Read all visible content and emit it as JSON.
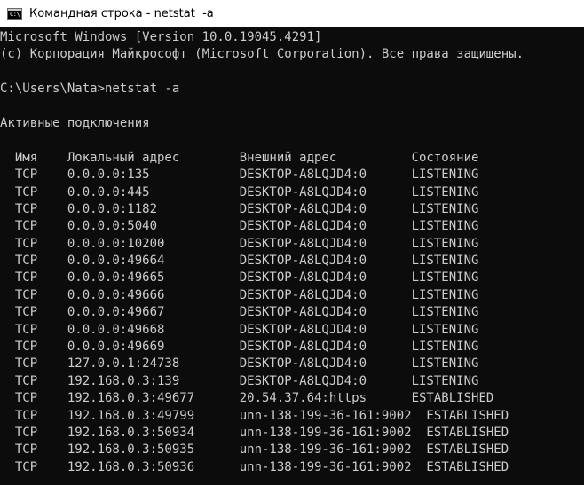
{
  "window": {
    "title": "Командная строка - netstat  -a",
    "icon": "cmd-icon",
    "icon_glyph": "C:\\",
    "background": "#0c0c0c",
    "foreground": "#cccccc"
  },
  "console": {
    "lines": [
      "Microsoft Windows [Version 10.0.19045.4291]",
      "(c) Корпорация Майкрософт (Microsoft Corporation). Все права защищены.",
      "",
      "C:\\Users\\Nata>netstat -a",
      "",
      "Активные подключения",
      "",
      "  Имя    Локальный адрес        Внешний адрес          Состояние",
      "  TCP    0.0.0.0:135            DESKTOP-A8LQJD4:0      LISTENING",
      "  TCP    0.0.0.0:445            DESKTOP-A8LQJD4:0      LISTENING",
      "  TCP    0.0.0.0:1182           DESKTOP-A8LQJD4:0      LISTENING",
      "  TCP    0.0.0.0:5040           DESKTOP-A8LQJD4:0      LISTENING",
      "  TCP    0.0.0.0:10200          DESKTOP-A8LQJD4:0      LISTENING",
      "  TCP    0.0.0.0:49664          DESKTOP-A8LQJD4:0      LISTENING",
      "  TCP    0.0.0.0:49665          DESKTOP-A8LQJD4:0      LISTENING",
      "  TCP    0.0.0.0:49666          DESKTOP-A8LQJD4:0      LISTENING",
      "  TCP    0.0.0.0:49667          DESKTOP-A8LQJD4:0      LISTENING",
      "  TCP    0.0.0.0:49668          DESKTOP-A8LQJD4:0      LISTENING",
      "  TCP    0.0.0.0:49669          DESKTOP-A8LQJD4:0      LISTENING",
      "  TCP    127.0.0.1:24738        DESKTOP-A8LQJD4:0      LISTENING",
      "  TCP    192.168.0.3:139        DESKTOP-A8LQJD4:0      LISTENING",
      "  TCP    192.168.0.3:49677      20.54.37.64:https      ESTABLISHED",
      "  TCP    192.168.0.3:49799      unn-138-199-36-161:9002  ESTABLISHED",
      "  TCP    192.168.0.3:50934      unn-138-199-36-161:9002  ESTABLISHED",
      "  TCP    192.168.0.3:50935      unn-138-199-36-161:9002  ESTABLISHED",
      "  TCP    192.168.0.3:50936      unn-138-199-36-161:9002  ESTABLISHED"
    ]
  }
}
